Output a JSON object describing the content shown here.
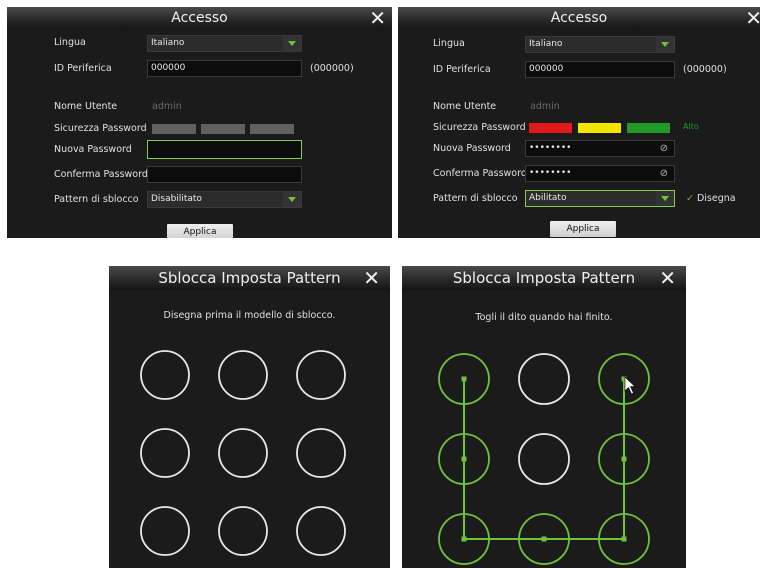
{
  "panel_a": {
    "title": "Accesso",
    "close": "✕",
    "labels": {
      "language": "Lingua",
      "device_id": "ID Periferica",
      "username": "Nome Utente",
      "password_strength": "Sicurezza Password",
      "new_password": "Nuova Password",
      "confirm_password": "Conferma Password",
      "unlock_pattern": "Pattern di sblocco"
    },
    "values": {
      "language": "Italiano",
      "device_id": "000000",
      "device_id_hint": "(000000)",
      "username": "admin",
      "new_password": "",
      "confirm_password": "",
      "unlock_pattern": "Disabilitato"
    },
    "strength_colors": [
      "#606060",
      "#606060",
      "#606060"
    ],
    "apply": "Applica"
  },
  "panel_b": {
    "title": "Accesso",
    "close": "✕",
    "labels": {
      "language": "Lingua",
      "device_id": "ID Periferica",
      "username": "Nome Utente",
      "password_strength": "Sicurezza Password",
      "new_password": "Nuova Password",
      "confirm_password": "Conferma Password",
      "unlock_pattern": "Pattern di sblocco"
    },
    "values": {
      "language": "Italiano",
      "device_id": "000000",
      "device_id_hint": "(000000)",
      "username": "admin",
      "new_password": "••••••••",
      "confirm_password": "••••••••",
      "unlock_pattern": "Abilitato",
      "strength_text": "Alto"
    },
    "strength_colors": [
      "#e01a1a",
      "#f2e600",
      "#1f9b27"
    ],
    "draw_label": "Disegna",
    "apply": "Applica"
  },
  "pattern_a": {
    "title": "Sblocca Imposta Pattern",
    "close": "✕",
    "message": "Disegna prima il modello di sblocco.",
    "selected_nodes": []
  },
  "pattern_b": {
    "title": "Sblocca Imposta Pattern",
    "close": "✕",
    "message": "Togli il dito quando hai finito.",
    "selected_nodes": [
      2,
      5,
      8,
      7,
      6,
      3,
      0
    ],
    "colors": {
      "active": "#6cc43a",
      "inactive": "#e8e8e8"
    }
  }
}
